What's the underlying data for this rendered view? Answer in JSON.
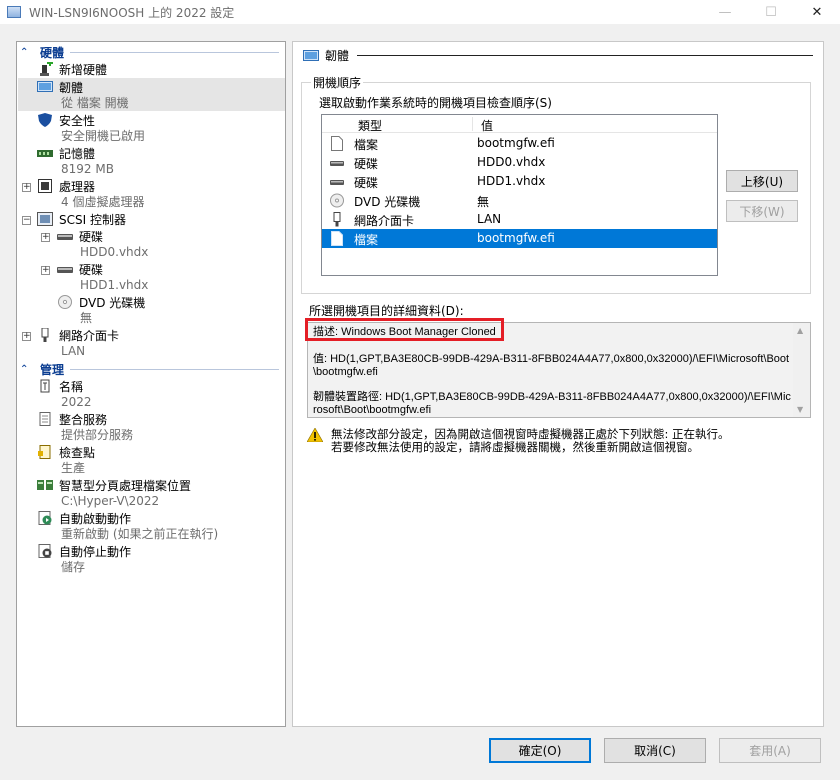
{
  "window": {
    "title": "WIN-LSN9I6NOOSH 上的 2022 設定",
    "controls": {
      "minimize": "—",
      "maximize": "☐",
      "close": "✕"
    }
  },
  "tree": {
    "hardware_header": "硬體",
    "management_header": "管理",
    "hardware": [
      {
        "label": "新增硬體",
        "icon": "add-hardware-icon"
      },
      {
        "label": "韌體",
        "sub": "從 檔案 開機",
        "icon": "firmware-icon"
      },
      {
        "label": "安全性",
        "sub": "安全開機已啟用",
        "icon": "shield-icon"
      },
      {
        "label": "記憶體",
        "sub": "8192 MB",
        "icon": "memory-icon"
      },
      {
        "label": "處理器",
        "sub": "4 個虛擬處理器",
        "icon": "processor-icon"
      },
      {
        "label": "SCSI 控制器",
        "icon": "scsi-icon"
      },
      {
        "label": "硬碟",
        "sub": "HDD0.vhdx",
        "icon": "hard-drive-icon"
      },
      {
        "label": "硬碟",
        "sub": "HDD1.vhdx",
        "icon": "hard-drive-icon"
      },
      {
        "label": "DVD 光碟機",
        "sub": "無",
        "icon": "dvd-icon"
      },
      {
        "label": "網路介面卡",
        "sub": "LAN",
        "icon": "network-adapter-icon"
      }
    ],
    "management": [
      {
        "label": "名稱",
        "sub": "2022",
        "icon": "name-icon"
      },
      {
        "label": "整合服務",
        "sub": "提供部分服務",
        "icon": "integration-icon"
      },
      {
        "label": "檢查點",
        "sub": "生產",
        "icon": "checkpoint-icon"
      },
      {
        "label": "智慧型分頁處理檔案位置",
        "sub": "C:\\Hyper-V\\2022",
        "icon": "paging-icon"
      },
      {
        "label": "自動啟動動作",
        "sub": "重新啟動 (如果之前正在執行)",
        "icon": "auto-start-icon"
      },
      {
        "label": "自動停止動作",
        "sub": "儲存",
        "icon": "auto-stop-icon"
      }
    ]
  },
  "panel": {
    "header": "韌體",
    "boot_order_title": "開機順序",
    "boot_order_desc": "選取啟動作業系統時的開機項目檢查順序(S)",
    "columns": {
      "type": "類型",
      "value": "值"
    },
    "boot_entries": [
      {
        "type": "檔案",
        "value": "bootmgfw.efi",
        "icon": "file-icon"
      },
      {
        "type": "硬碟",
        "value": "HDD0.vhdx",
        "icon": "hard-drive-icon"
      },
      {
        "type": "硬碟",
        "value": "HDD1.vhdx",
        "icon": "hard-drive-icon"
      },
      {
        "type": "DVD 光碟機",
        "value": "無",
        "icon": "dvd-icon"
      },
      {
        "type": "網路介面卡",
        "value": "LAN",
        "icon": "network-adapter-icon"
      },
      {
        "type": "檔案",
        "value": "bootmgfw.efi",
        "icon": "file-icon",
        "selected": true
      }
    ],
    "move_up": "上移(U)",
    "move_down": "下移(W)",
    "details_label": "所選開機項目的詳細資料(D):",
    "details": {
      "description": "描述: Windows Boot Manager Cloned",
      "value": "值: HD(1,GPT,BA3E80CB-99DB-429A-B311-8FBB024A4A77,0x800,0x32000)/\\EFI\\Microsoft\\Boot\\bootmgfw.efi",
      "firmware_path": "韌體裝置路徑: HD(1,GPT,BA3E80CB-99DB-429A-B311-8FBB024A4A77,0x800,0x32000)/\\EFI\\Microsoft\\Boot\\bootmgfw.efi"
    },
    "warning": "無法修改部分設定，因為開啟這個視窗時虛擬機器正處於下列狀態: 正在執行。\n若要修改無法使用的設定，請將虛擬機器關機，然後重新開啟這個視窗。"
  },
  "footer": {
    "ok": "確定(O)",
    "cancel": "取消(C)",
    "apply": "套用(A)"
  },
  "colors": {
    "selection": "#0078d7",
    "highlight_border": "#e41e26",
    "accent": "#0b3d91"
  }
}
